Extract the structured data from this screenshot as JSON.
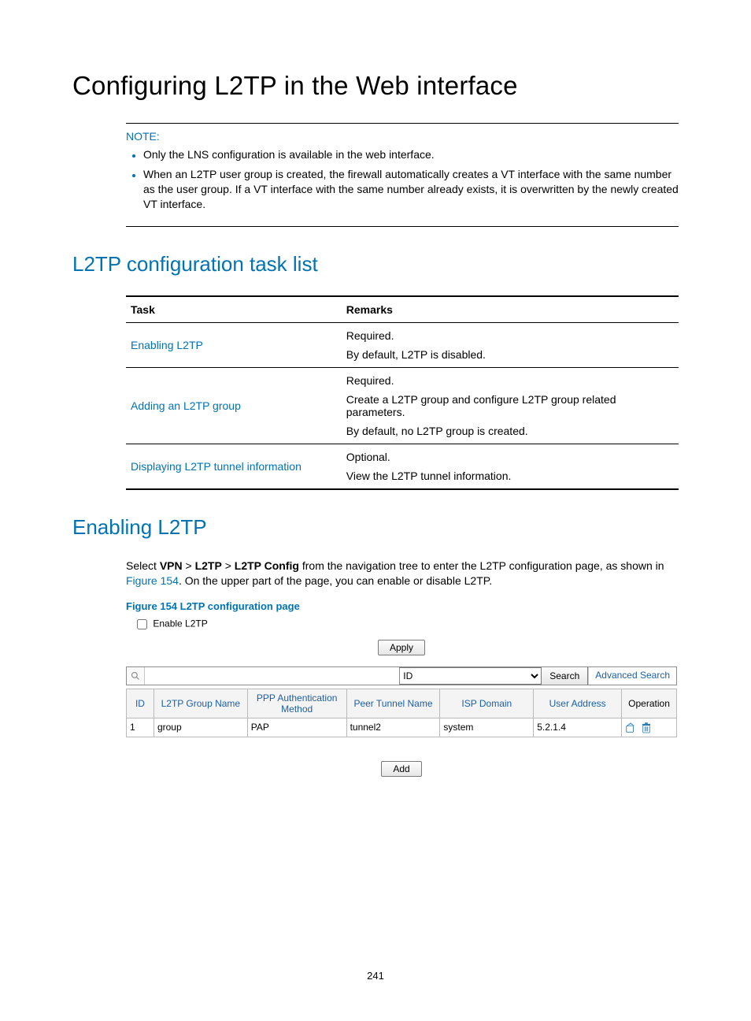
{
  "page_number": "241",
  "title": "Configuring L2TP in the Web interface",
  "note": {
    "label": "NOTE:",
    "items": [
      "Only the LNS configuration is available in the web interface.",
      "When an L2TP user group is created, the firewall automatically creates a VT interface with the same number as the user group. If a VT interface with the same number already exists, it is overwritten by the newly created VT interface."
    ]
  },
  "task_section_title": "L2TP configuration task list",
  "task_table": {
    "headers": {
      "task": "Task",
      "remarks": "Remarks"
    },
    "rows": [
      {
        "task": "Enabling L2TP",
        "remarks": [
          "Required.",
          "By default, L2TP is disabled."
        ]
      },
      {
        "task": "Adding an L2TP group",
        "remarks": [
          "Required.",
          "Create a L2TP group and configure L2TP group related parameters.",
          "By default, no L2TP group is created."
        ]
      },
      {
        "task": "Displaying L2TP tunnel information",
        "remarks": [
          "Optional.",
          "View the L2TP tunnel information."
        ]
      }
    ]
  },
  "enabling_section_title": "Enabling L2TP",
  "enabling_paragraph": {
    "pre": "Select ",
    "nav1": "VPN",
    "sep": " > ",
    "nav2": "L2TP",
    "nav3": "L2TP Config",
    "mid": " from the navigation tree to enter the L2TP configuration page, as shown in ",
    "fig_ref": "Figure 154",
    "post": ". On the upper part of the page, you can enable or disable L2TP."
  },
  "figure_caption": "Figure 154 L2TP configuration page",
  "ui": {
    "enable_label": "Enable L2TP",
    "apply_label": "Apply",
    "search_select_value": "ID",
    "search_btn": "Search",
    "advanced_search": "Advanced Search",
    "grid_headers": {
      "id": "ID",
      "group": "L2TP Group Name",
      "ppp": "PPP Authentication Method",
      "peer": "Peer Tunnel Name",
      "isp": "ISP Domain",
      "addr": "User Address",
      "op": "Operation"
    },
    "row": {
      "id": "1",
      "group": "group",
      "ppp": "PAP",
      "peer": "tunnel2",
      "isp": "system",
      "addr": "5.2.1.4"
    },
    "add_label": "Add"
  }
}
